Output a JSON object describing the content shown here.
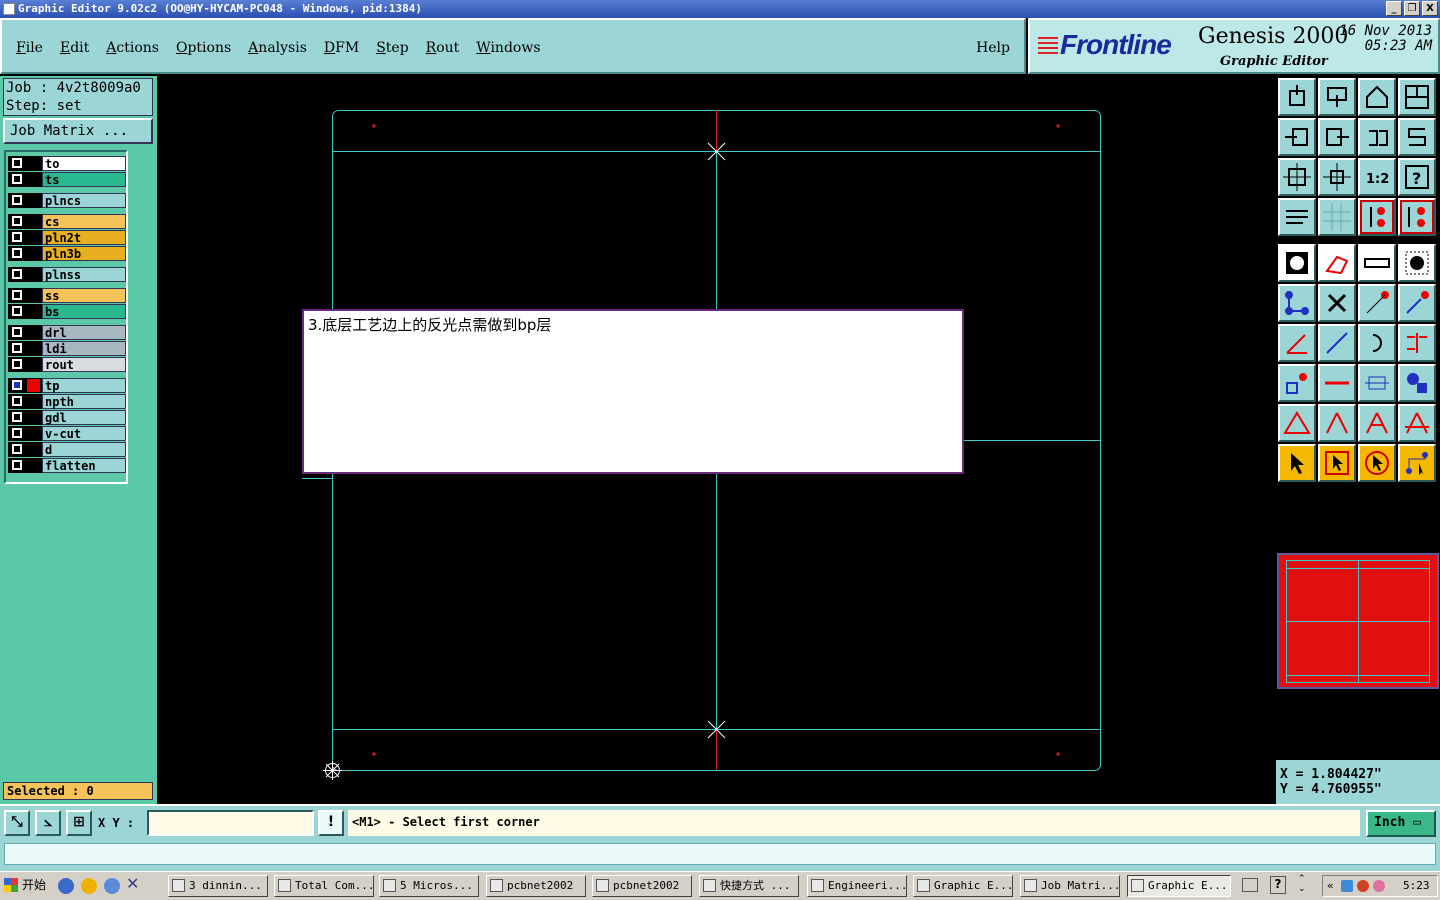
{
  "window": {
    "title": "Graphic Editor 9.02c2  (OO@HY-HYCAM-PC048 - Windows, pid:1384)",
    "controls": [
      "_",
      "❐",
      "X"
    ]
  },
  "menubar": {
    "items": [
      "File",
      "Edit",
      "Actions",
      "Options",
      "Analysis",
      "DFM",
      "Step",
      "Rout",
      "Windows"
    ],
    "help": "Help"
  },
  "brand": {
    "logo": "Frontline",
    "product": "Genesis 2000",
    "subtitle": "Graphic Editor",
    "date": "16 Nov 2013",
    "time": "05:23 AM"
  },
  "job": {
    "job_line": "Job : 4v2t8009a0",
    "step_line": "Step: set",
    "matrix_button": "Job Matrix ..."
  },
  "layers": [
    {
      "name": "to",
      "color": "#ffffff"
    },
    {
      "name": "ts",
      "color": "#2ab890"
    },
    {
      "name": "plncs",
      "color": "#9bd5d5"
    },
    {
      "name": "cs",
      "color": "#f5c35a"
    },
    {
      "name": "pln2t",
      "color": "#e8b020"
    },
    {
      "name": "pln3b",
      "color": "#e8b020"
    },
    {
      "name": "plnss",
      "color": "#9bd5d5"
    },
    {
      "name": "ss",
      "color": "#f5c35a"
    },
    {
      "name": "bs",
      "color": "#2ab890"
    },
    {
      "name": "drl",
      "color": "#a8b8c0"
    },
    {
      "name": "ldi",
      "color": "#a8b8c0"
    },
    {
      "name": "rout",
      "color": "#d8dce0"
    },
    {
      "name": "tp",
      "color": "#9bd5d5",
      "active": true
    },
    {
      "name": "npth",
      "color": "#9bd5d5"
    },
    {
      "name": "gdl",
      "color": "#9bd5d5"
    },
    {
      "name": "v-cut",
      "color": "#9bd5d5"
    },
    {
      "name": "d",
      "color": "#9bd5d5"
    },
    {
      "name": "flatten",
      "color": "#9bd5d5"
    }
  ],
  "selected_label": "Selected : 0",
  "canvas": {
    "message": "3.底层工艺边上的反光点需做到bp层",
    "outline_color": "#40c8c8",
    "fiducial_color": "#e02020"
  },
  "toolbar": {
    "icons": [
      "zoom-home-icon",
      "zoom-page-icon",
      "home-icon",
      "split-view-icon",
      "pan-left-icon",
      "pan-right-icon",
      "rotate-icon",
      "mirror-icon",
      "fit-vertical-icon",
      "fit-center-icon",
      "scale-1-2-label",
      "help-query-icon",
      "tools-icon",
      "grid-icon",
      "snap-layers-icon",
      "snap-layers-alt-icon",
      "pad-select-icon",
      "polygon-icon",
      "ruler-icon",
      "circle-select-icon",
      "network-icon",
      "cross-icon",
      "line-points-icon",
      "line-point-icon",
      "angle-icon",
      "diagonal-line-icon",
      "arc-icon",
      "align-icon",
      "move-point-icon",
      "horizontal-line-icon",
      "measure-icon",
      "shapes-icon",
      "triangle-icon",
      "a-frame-icon",
      "a-frame-alt-icon",
      "a-frame-cross-icon",
      "pointer-icon",
      "pointer-box-icon",
      "pointer-circle-icon",
      "pointer-net-icon"
    ],
    "scale_text": "1:2"
  },
  "coords": {
    "x_line": "X = 1.804427\"",
    "y_line": "Y = 4.760955\""
  },
  "bottom": {
    "xy_label": "X Y :",
    "xy_value": "",
    "prompt": "<M1> - Select first corner",
    "units": "Inch",
    "warn": "!"
  },
  "taskbar": {
    "start": "开始",
    "buttons": [
      "3 dinnin...",
      "Total Com...",
      "5 Micros...",
      "pcbnet2002",
      "pcbnet2002",
      "快捷方式 ...",
      "Engineeri...",
      "Graphic E...",
      "Job Matri...",
      "Graphic E..."
    ],
    "clock": "5:23"
  }
}
